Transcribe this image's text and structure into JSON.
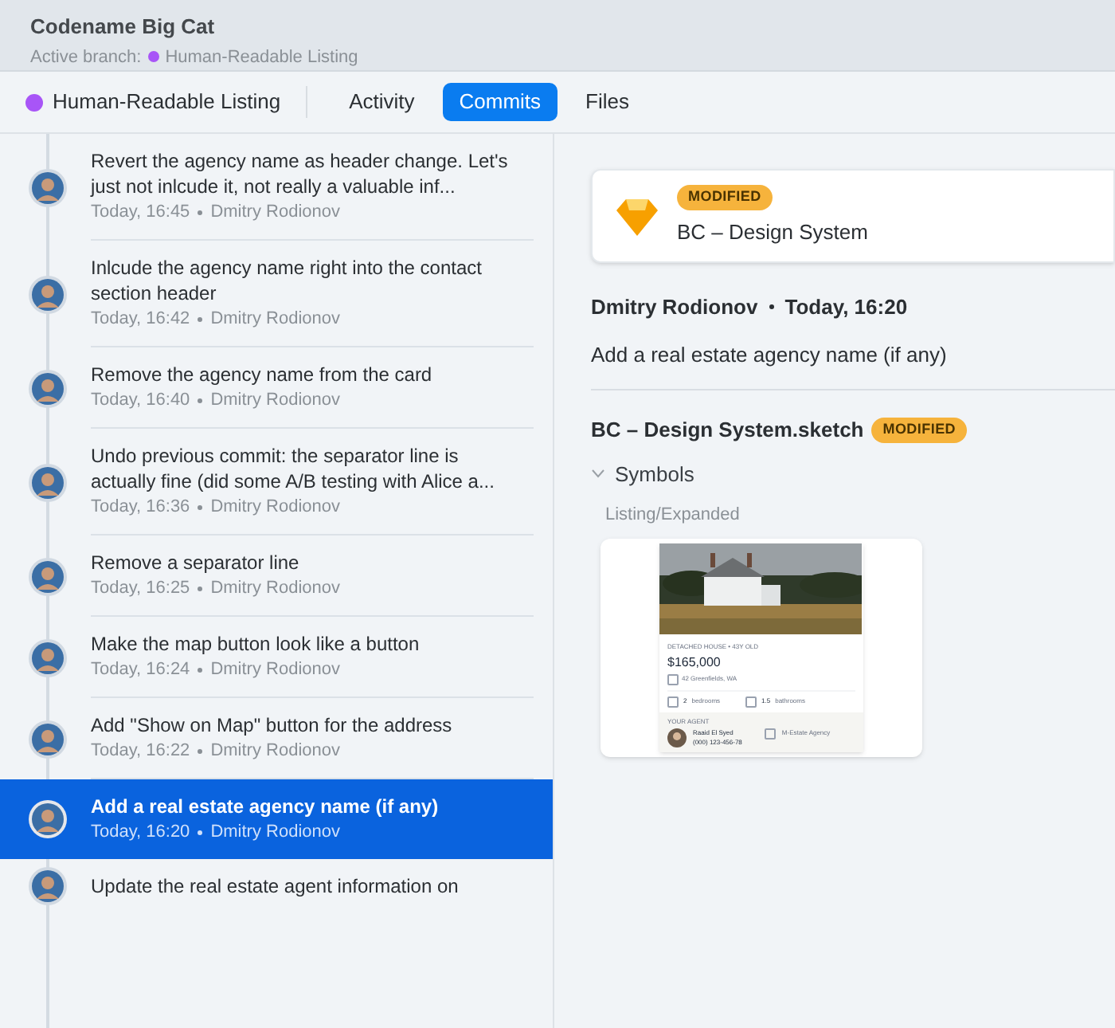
{
  "window": {
    "title": "Codename Big Cat",
    "branch_label": "Active branch:",
    "branch": "Human-Readable Listing"
  },
  "toolbar": {
    "branch": "Human-Readable Listing",
    "tabs": [
      {
        "label": "Activity",
        "selected": false
      },
      {
        "label": "Commits",
        "selected": true
      },
      {
        "label": "Files",
        "selected": false
      }
    ]
  },
  "commits": [
    {
      "message": "Revert the agency name as header change. Let's just not inlcude it, not really a valuable inf...",
      "time": "Today, 16:45",
      "author": "Dmitry Rodionov",
      "selected": false
    },
    {
      "message": "Inlcude the agency name right into the contact section header",
      "time": "Today, 16:42",
      "author": "Dmitry Rodionov",
      "selected": false
    },
    {
      "message": "Remove the agency name from the card",
      "time": "Today, 16:40",
      "author": "Dmitry Rodionov",
      "selected": false
    },
    {
      "message": "Undo previous commit: the separator line is actually fine (did some A/B testing with Alice a...",
      "time": "Today, 16:36",
      "author": "Dmitry Rodionov",
      "selected": false
    },
    {
      "message": "Remove a separator line",
      "time": "Today, 16:25",
      "author": "Dmitry Rodionov",
      "selected": false
    },
    {
      "message": "Make the map button look like a button",
      "time": "Today, 16:24",
      "author": "Dmitry Rodionov",
      "selected": false
    },
    {
      "message": "Add \"Show on Map\" button for the address",
      "time": "Today, 16:22",
      "author": "Dmitry Rodionov",
      "selected": false
    },
    {
      "message": "Add a real estate agency name (if any)",
      "time": "Today, 16:20",
      "author": "Dmitry Rodionov",
      "selected": true
    },
    {
      "message": "Update the real estate agent information on",
      "selected": false
    }
  ],
  "detail": {
    "file_card": {
      "badge": "MODIFIED",
      "name": "BC – Design System"
    },
    "author": "Dmitry Rodionov",
    "time": "Today, 16:20",
    "message": "Add a real estate agency name (if any)",
    "file": {
      "name": "BC – Design System.sketch",
      "badge": "MODIFIED",
      "group": "Symbols",
      "expanded": true,
      "symbol": "Listing/Expanded",
      "preview": {
        "type_line": "DETACHED HOUSE • 43Y OLD",
        "price": "$165,000",
        "address": "42 Greenfields, WA",
        "bedrooms_count": "2",
        "bedrooms": "bedrooms",
        "bathrooms_count": "1.5",
        "bathrooms": "bathrooms",
        "agent_heading": "YOUR AGENT",
        "agent": "Raaid El Syed",
        "phone": "(000) 123-456-78",
        "agency": "M-Estate Agency"
      }
    }
  }
}
